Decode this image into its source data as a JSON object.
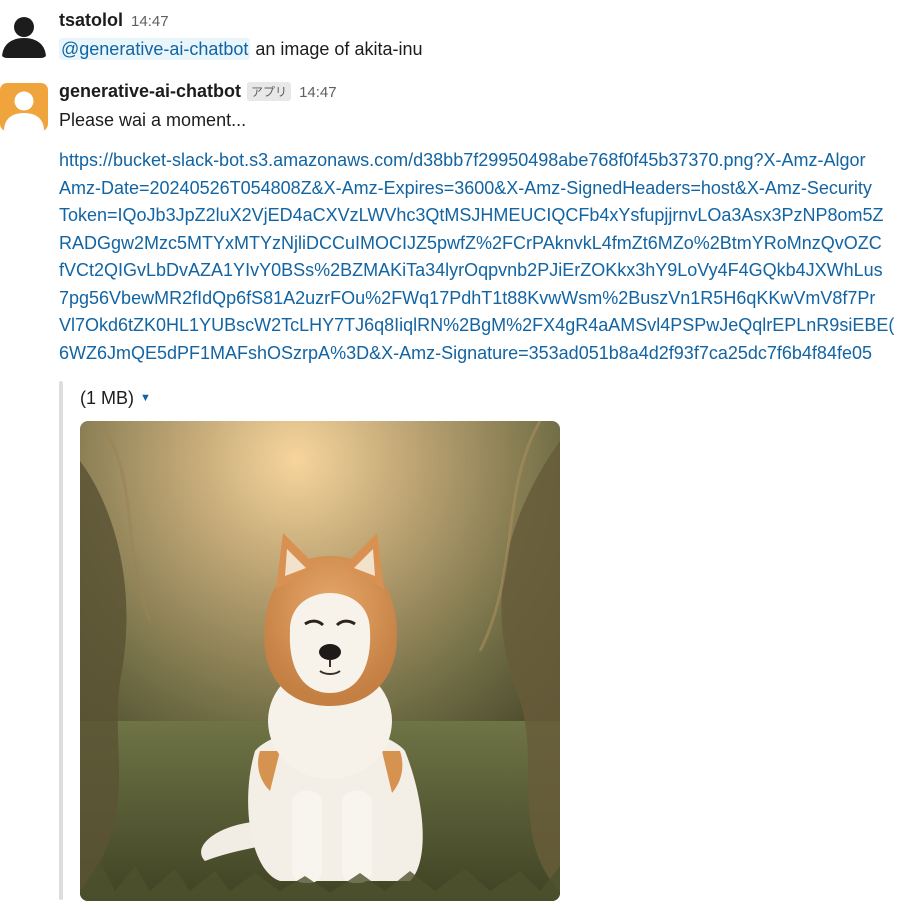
{
  "messages": [
    {
      "author": "tsatolol",
      "time": "14:47",
      "mention": "@generative-ai-chatbot",
      "text": " an image of akita-inu"
    },
    {
      "author": "generative-ai-chatbot",
      "badge": "アプリ",
      "time": "14:47",
      "text": "Please wai a moment...",
      "url_lines": [
        "https://bucket-slack-bot.s3.amazonaws.com/d38bb7f29950498abe768f0f45b37370.png?X-Amz-Algor",
        "Amz-Date=20240526T054808Z&X-Amz-Expires=3600&X-Amz-SignedHeaders=host&X-Amz-Security",
        "Token=IQoJb3JpZ2luX2VjED4aCXVzLWVhc3QtMSJHMEUCIQCFb4xYsfupjjrnvLOa3Asx3PzNP8om5Z",
        "RADGgw2Mzc5MTYxMTYzNjliDCCuIMOCIJZ5pwfZ%2FCrPAknvkL4fmZt6MZo%2BtmYRoMnzQvOZC",
        "fVCt2QIGvLbDvAZA1YIvY0BSs%2BZMAKiTa34lyrOqpvnb2PJiErZOKkx3hY9LoVy4F4GQkb4JXWhLus",
        "7pg56VbewMR2fIdQp6fS81A2uzrFOu%2FWq17PdhT1t88KvwWsm%2BuszVn1R5H6qKKwVmV8f7Pr",
        "Vl7Okd6tZK0HL1YUBscW2TcLHY7TJ6q8IiqlRN%2BgM%2FX4gR4aAMSvl4PSPwJeQqlrEPLnR9siEBE(",
        "6WZ6JmQE5dPF1MAFshOSzrpA%3D&X-Amz-Signature=353ad051b8a4d2f93f7ca25dc7f6b4f84fe05"
      ],
      "attachment": {
        "size_label": "(1 MB)",
        "image": "akita-inu-dog-photo"
      }
    }
  ],
  "colors": {
    "link": "#1264a3",
    "mention_bg": "#e8f5fa",
    "bot_avatar": "#f0a53c",
    "user_avatar": "#1d1c1d"
  },
  "icons": {
    "user_avatar": "person-silhouette-icon",
    "bot_avatar": "person-silhouette-icon",
    "dropdown": "caret-down-icon"
  }
}
